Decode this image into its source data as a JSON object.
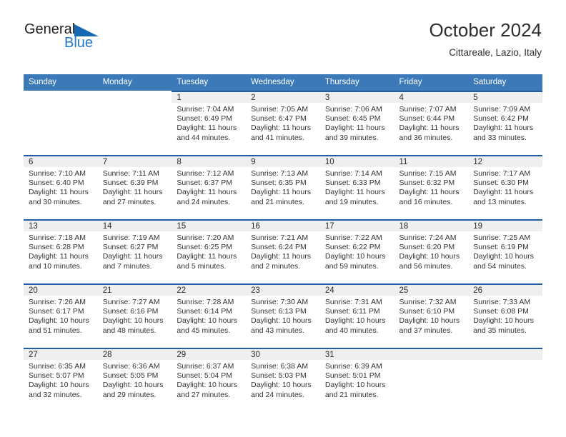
{
  "brand": {
    "line1": "General",
    "line2": "Blue",
    "triangle_color": "#1668b3"
  },
  "header": {
    "title": "October 2024",
    "subtitle": "Cittareale, Lazio, Italy"
  },
  "theme": {
    "header_blue": "#3b79b8",
    "divider_blue": "#1f5fa8",
    "daynum_band": "#efefef",
    "brand_blue": "#2277c8"
  },
  "labels": {
    "sunrise": "Sunrise:",
    "sunset": "Sunset:",
    "daylight": "Daylight:"
  },
  "weekdays": [
    "Sunday",
    "Monday",
    "Tuesday",
    "Wednesday",
    "Thursday",
    "Friday",
    "Saturday"
  ],
  "weeks": [
    [
      {
        "blank": true
      },
      {
        "blank": true
      },
      {
        "day": "1",
        "sunrise": "Sunrise: 7:04 AM",
        "sunset": "Sunset: 6:49 PM",
        "daylight1": "Daylight: 11 hours",
        "daylight2": "and 44 minutes."
      },
      {
        "day": "2",
        "sunrise": "Sunrise: 7:05 AM",
        "sunset": "Sunset: 6:47 PM",
        "daylight1": "Daylight: 11 hours",
        "daylight2": "and 41 minutes."
      },
      {
        "day": "3",
        "sunrise": "Sunrise: 7:06 AM",
        "sunset": "Sunset: 6:45 PM",
        "daylight1": "Daylight: 11 hours",
        "daylight2": "and 39 minutes."
      },
      {
        "day": "4",
        "sunrise": "Sunrise: 7:07 AM",
        "sunset": "Sunset: 6:44 PM",
        "daylight1": "Daylight: 11 hours",
        "daylight2": "and 36 minutes."
      },
      {
        "day": "5",
        "sunrise": "Sunrise: 7:09 AM",
        "sunset": "Sunset: 6:42 PM",
        "daylight1": "Daylight: 11 hours",
        "daylight2": "and 33 minutes."
      }
    ],
    [
      {
        "day": "6",
        "sunrise": "Sunrise: 7:10 AM",
        "sunset": "Sunset: 6:40 PM",
        "daylight1": "Daylight: 11 hours",
        "daylight2": "and 30 minutes."
      },
      {
        "day": "7",
        "sunrise": "Sunrise: 7:11 AM",
        "sunset": "Sunset: 6:39 PM",
        "daylight1": "Daylight: 11 hours",
        "daylight2": "and 27 minutes."
      },
      {
        "day": "8",
        "sunrise": "Sunrise: 7:12 AM",
        "sunset": "Sunset: 6:37 PM",
        "daylight1": "Daylight: 11 hours",
        "daylight2": "and 24 minutes."
      },
      {
        "day": "9",
        "sunrise": "Sunrise: 7:13 AM",
        "sunset": "Sunset: 6:35 PM",
        "daylight1": "Daylight: 11 hours",
        "daylight2": "and 21 minutes."
      },
      {
        "day": "10",
        "sunrise": "Sunrise: 7:14 AM",
        "sunset": "Sunset: 6:33 PM",
        "daylight1": "Daylight: 11 hours",
        "daylight2": "and 19 minutes."
      },
      {
        "day": "11",
        "sunrise": "Sunrise: 7:15 AM",
        "sunset": "Sunset: 6:32 PM",
        "daylight1": "Daylight: 11 hours",
        "daylight2": "and 16 minutes."
      },
      {
        "day": "12",
        "sunrise": "Sunrise: 7:17 AM",
        "sunset": "Sunset: 6:30 PM",
        "daylight1": "Daylight: 11 hours",
        "daylight2": "and 13 minutes."
      }
    ],
    [
      {
        "day": "13",
        "sunrise": "Sunrise: 7:18 AM",
        "sunset": "Sunset: 6:28 PM",
        "daylight1": "Daylight: 11 hours",
        "daylight2": "and 10 minutes."
      },
      {
        "day": "14",
        "sunrise": "Sunrise: 7:19 AM",
        "sunset": "Sunset: 6:27 PM",
        "daylight1": "Daylight: 11 hours",
        "daylight2": "and 7 minutes."
      },
      {
        "day": "15",
        "sunrise": "Sunrise: 7:20 AM",
        "sunset": "Sunset: 6:25 PM",
        "daylight1": "Daylight: 11 hours",
        "daylight2": "and 5 minutes."
      },
      {
        "day": "16",
        "sunrise": "Sunrise: 7:21 AM",
        "sunset": "Sunset: 6:24 PM",
        "daylight1": "Daylight: 11 hours",
        "daylight2": "and 2 minutes."
      },
      {
        "day": "17",
        "sunrise": "Sunrise: 7:22 AM",
        "sunset": "Sunset: 6:22 PM",
        "daylight1": "Daylight: 10 hours",
        "daylight2": "and 59 minutes."
      },
      {
        "day": "18",
        "sunrise": "Sunrise: 7:24 AM",
        "sunset": "Sunset: 6:20 PM",
        "daylight1": "Daylight: 10 hours",
        "daylight2": "and 56 minutes."
      },
      {
        "day": "19",
        "sunrise": "Sunrise: 7:25 AM",
        "sunset": "Sunset: 6:19 PM",
        "daylight1": "Daylight: 10 hours",
        "daylight2": "and 54 minutes."
      }
    ],
    [
      {
        "day": "20",
        "sunrise": "Sunrise: 7:26 AM",
        "sunset": "Sunset: 6:17 PM",
        "daylight1": "Daylight: 10 hours",
        "daylight2": "and 51 minutes."
      },
      {
        "day": "21",
        "sunrise": "Sunrise: 7:27 AM",
        "sunset": "Sunset: 6:16 PM",
        "daylight1": "Daylight: 10 hours",
        "daylight2": "and 48 minutes."
      },
      {
        "day": "22",
        "sunrise": "Sunrise: 7:28 AM",
        "sunset": "Sunset: 6:14 PM",
        "daylight1": "Daylight: 10 hours",
        "daylight2": "and 45 minutes."
      },
      {
        "day": "23",
        "sunrise": "Sunrise: 7:30 AM",
        "sunset": "Sunset: 6:13 PM",
        "daylight1": "Daylight: 10 hours",
        "daylight2": "and 43 minutes."
      },
      {
        "day": "24",
        "sunrise": "Sunrise: 7:31 AM",
        "sunset": "Sunset: 6:11 PM",
        "daylight1": "Daylight: 10 hours",
        "daylight2": "and 40 minutes."
      },
      {
        "day": "25",
        "sunrise": "Sunrise: 7:32 AM",
        "sunset": "Sunset: 6:10 PM",
        "daylight1": "Daylight: 10 hours",
        "daylight2": "and 37 minutes."
      },
      {
        "day": "26",
        "sunrise": "Sunrise: 7:33 AM",
        "sunset": "Sunset: 6:08 PM",
        "daylight1": "Daylight: 10 hours",
        "daylight2": "and 35 minutes."
      }
    ],
    [
      {
        "day": "27",
        "sunrise": "Sunrise: 6:35 AM",
        "sunset": "Sunset: 5:07 PM",
        "daylight1": "Daylight: 10 hours",
        "daylight2": "and 32 minutes."
      },
      {
        "day": "28",
        "sunrise": "Sunrise: 6:36 AM",
        "sunset": "Sunset: 5:05 PM",
        "daylight1": "Daylight: 10 hours",
        "daylight2": "and 29 minutes."
      },
      {
        "day": "29",
        "sunrise": "Sunrise: 6:37 AM",
        "sunset": "Sunset: 5:04 PM",
        "daylight1": "Daylight: 10 hours",
        "daylight2": "and 27 minutes."
      },
      {
        "day": "30",
        "sunrise": "Sunrise: 6:38 AM",
        "sunset": "Sunset: 5:03 PM",
        "daylight1": "Daylight: 10 hours",
        "daylight2": "and 24 minutes."
      },
      {
        "day": "31",
        "sunrise": "Sunrise: 6:39 AM",
        "sunset": "Sunset: 5:01 PM",
        "daylight1": "Daylight: 10 hours",
        "daylight2": "and 21 minutes."
      },
      {
        "day": "",
        "sunrise": "",
        "sunset": "",
        "daylight1": "",
        "daylight2": ""
      },
      {
        "day": "",
        "sunrise": "",
        "sunset": "",
        "daylight1": "",
        "daylight2": ""
      }
    ]
  ]
}
